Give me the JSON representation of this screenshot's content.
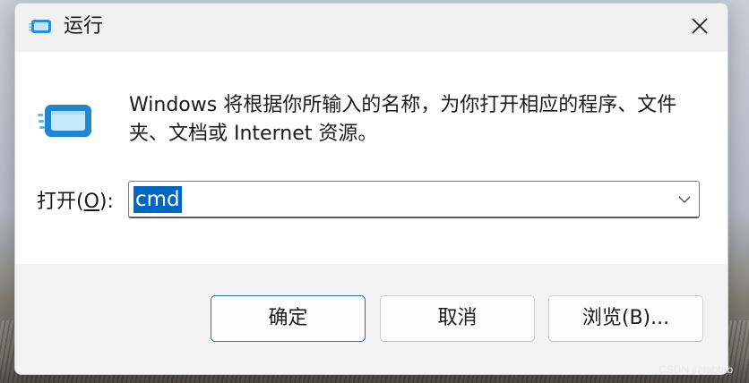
{
  "window": {
    "title": "运行",
    "icon": "run-icon",
    "close_icon": "close-icon"
  },
  "description": "Windows 将根据你所输入的名称，为你打开相应的程序、文件夹、文档或 Internet 资源。",
  "open": {
    "label_prefix": "打开(",
    "label_accel": "O",
    "label_suffix": "):",
    "value": "cmd",
    "value_selected": true,
    "dropdown_icon": "chevron-down-icon"
  },
  "buttons": {
    "ok": "确定",
    "cancel": "取消",
    "browse": "浏览(B)..."
  },
  "watermark": "CSDN @tabtab",
  "colors": {
    "selection": "#0067c0",
    "primary_border": "#2c6fb5",
    "dialog_bg": "#f3f3f3",
    "content_bg": "#ffffff"
  }
}
